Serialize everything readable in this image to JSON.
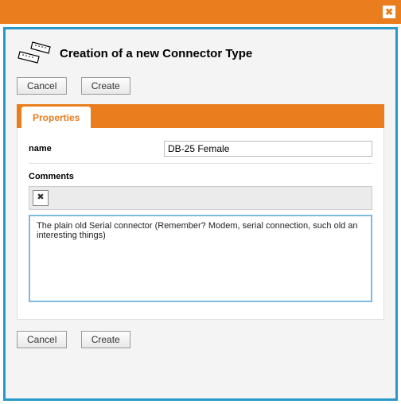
{
  "window": {
    "close_glyph": "✖"
  },
  "header": {
    "title": "Creation of a new Connector Type"
  },
  "buttons": {
    "cancel": "Cancel",
    "create": "Create"
  },
  "tabs": {
    "properties": "Properties"
  },
  "form": {
    "name_label": "name",
    "name_value": "DB-25 Female",
    "comments_label": "Comments",
    "comments_value": "The plain old Serial connector (Remember? Modem, serial connection, such old an interesting things)",
    "clear_glyph": "✖"
  }
}
